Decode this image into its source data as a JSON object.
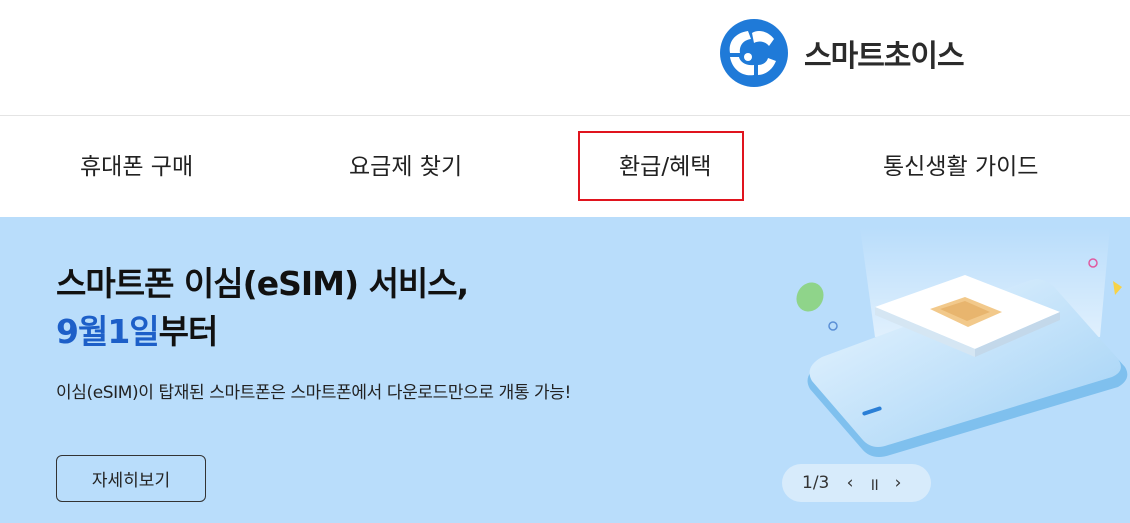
{
  "header": {
    "brand_name": "스마트초이스",
    "brand_icon": "smart-choice-logo-icon",
    "colors": {
      "brand_blue": "#1f7ad8",
      "text": "#2b2b2b"
    }
  },
  "nav": {
    "items": [
      {
        "label": "휴대폰 구매"
      },
      {
        "label": "요금제 찾기"
      },
      {
        "label": "환급/혜택"
      },
      {
        "label": "통신생활 가이드"
      }
    ],
    "highlight_color": "#e0141e"
  },
  "banner": {
    "title_line1": "스마트폰 이심(eSIM) 서비스,",
    "title_highlight": "9월1일",
    "title_line2_rest": "부터",
    "subtitle": "이심(eSIM)이 탑재된 스마트폰은 스마트폰에서 다운로드만으로 개통 가능!",
    "detail_button": "자세히보기",
    "background_color": "#b9ddfb",
    "highlight_color": "#1d5fc8",
    "pager": {
      "count": "1/3",
      "prev_icon": "‹",
      "pause_icon": "॥",
      "next_icon": "›"
    }
  }
}
